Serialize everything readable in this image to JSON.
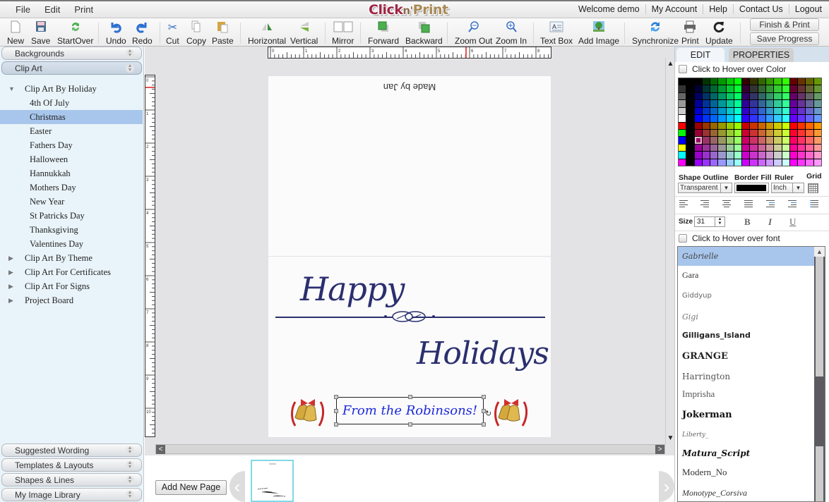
{
  "app": {
    "logo": {
      "part1": "Click",
      "part2": "n'",
      "part3": "Print"
    },
    "menu": [
      "File",
      "Edit",
      "Print"
    ],
    "user_nav": {
      "welcome": "Welcome demo",
      "links": [
        "My Account",
        "Help",
        "Contact Us",
        "Logout"
      ]
    }
  },
  "toolbar": {
    "buttons": [
      {
        "id": "new",
        "label": "New",
        "icon": "new-document-icon"
      },
      {
        "id": "save",
        "label": "Save",
        "icon": "floppy-disk-icon"
      },
      {
        "id": "startover",
        "label": "StartOver",
        "icon": "refresh-arrows-icon"
      },
      {
        "id": "undo",
        "label": "Undo",
        "icon": "undo-icon"
      },
      {
        "id": "redo",
        "label": "Redo",
        "icon": "redo-icon"
      },
      {
        "id": "cut",
        "label": "Cut",
        "icon": "scissors-icon"
      },
      {
        "id": "copy",
        "label": "Copy",
        "icon": "copy-icon"
      },
      {
        "id": "paste",
        "label": "Paste",
        "icon": "clipboard-icon"
      },
      {
        "id": "horizontal",
        "label": "Horizontal",
        "icon": "flip-horizontal-icon"
      },
      {
        "id": "vertical",
        "label": "Vertical",
        "icon": "flip-vertical-icon"
      },
      {
        "id": "mirror",
        "label": "Mirror",
        "icon": "mirror-pages-icon"
      },
      {
        "id": "forward",
        "label": "Forward",
        "icon": "bring-forward-icon"
      },
      {
        "id": "backward",
        "label": "Backward",
        "icon": "send-backward-icon"
      },
      {
        "id": "zoomout",
        "label": "Zoom Out",
        "icon": "zoom-out-icon"
      },
      {
        "id": "zoomin",
        "label": "Zoom In",
        "icon": "zoom-in-icon"
      },
      {
        "id": "textbox",
        "label": "Text Box",
        "icon": "text-box-icon"
      },
      {
        "id": "addimage",
        "label": "Add Image",
        "icon": "add-image-icon"
      },
      {
        "id": "synchronize",
        "label": "Synchronize",
        "icon": "sync-icon"
      },
      {
        "id": "print",
        "label": "Print",
        "icon": "printer-icon"
      },
      {
        "id": "update",
        "label": "Update",
        "icon": "update-icon"
      }
    ],
    "finish_print": "Finish & Print",
    "save_progress": "Save Progress"
  },
  "sidebar": {
    "top_sections": [
      "Backgrounds",
      "Clip Art"
    ],
    "active_section": "Clip Art",
    "tree": {
      "expanded_group": "Clip Art By Holiday",
      "children": [
        "4th Of July",
        "Christmas",
        "Easter",
        "Fathers Day",
        "Halloween",
        "Hannukkah",
        "Mothers Day",
        "New Year",
        "St Patricks Day",
        "Thanksgiving",
        "Valentines Day"
      ],
      "selected": "Christmas",
      "collapsed_groups": [
        "Clip Art By Theme",
        "Clip Art For Certificates",
        "Clip Art For Signs",
        "Project Board"
      ]
    },
    "bottom_sections": [
      "Suggested Wording",
      "Templates & Layouts",
      "Shapes & Lines",
      "My Image Library"
    ]
  },
  "canvas": {
    "ruler_h_labels": [
      "0",
      "1",
      "2",
      "3",
      "4",
      "5",
      "6",
      "7",
      "8"
    ],
    "ruler_v_labels": [
      "0",
      "1",
      "2",
      "3",
      "4",
      "5",
      "6",
      "7",
      "8",
      "9",
      "10"
    ],
    "card": {
      "back_text": "Made by Jan",
      "greeting_line1": "Happy",
      "greeting_line2": "Holidays",
      "text_box": "From the Robinsons!",
      "text_color": "#1d2ad8",
      "greeting_color": "#2b2f6e"
    }
  },
  "pages": {
    "add_page_label": "Add New Page",
    "page_count": 1,
    "selected_page": 1
  },
  "right_panel": {
    "tabs": [
      "EDIT",
      "PROPERTIES"
    ],
    "active_tab": "EDIT",
    "hover_color_label": "Click to Hover over Color",
    "hover_color_checked": false,
    "labels": {
      "shape_outline": "Shape Outline",
      "border_fill": "Border Fill",
      "ruler": "Ruler",
      "grid": "Grid",
      "size": "Size"
    },
    "shape_outline_value": "Transparent",
    "border_fill_color": "#000000",
    "ruler_value": "Inch",
    "font_size": "31",
    "style_buttons": [
      "B",
      "I",
      "U"
    ],
    "hover_font_label": "Click to Hover over font",
    "hover_font_checked": false,
    "fonts": [
      "Gabrielle",
      "Gara",
      "Giddyup",
      "Gigi",
      "Gilligans_Island",
      "GRANGE",
      "Harrington",
      "Imprisha",
      "Jokerman",
      "Liberty_",
      "Matura_Script",
      "Modern_No",
      "Monotype_Corsiva"
    ],
    "selected_font": "Gabrielle"
  }
}
